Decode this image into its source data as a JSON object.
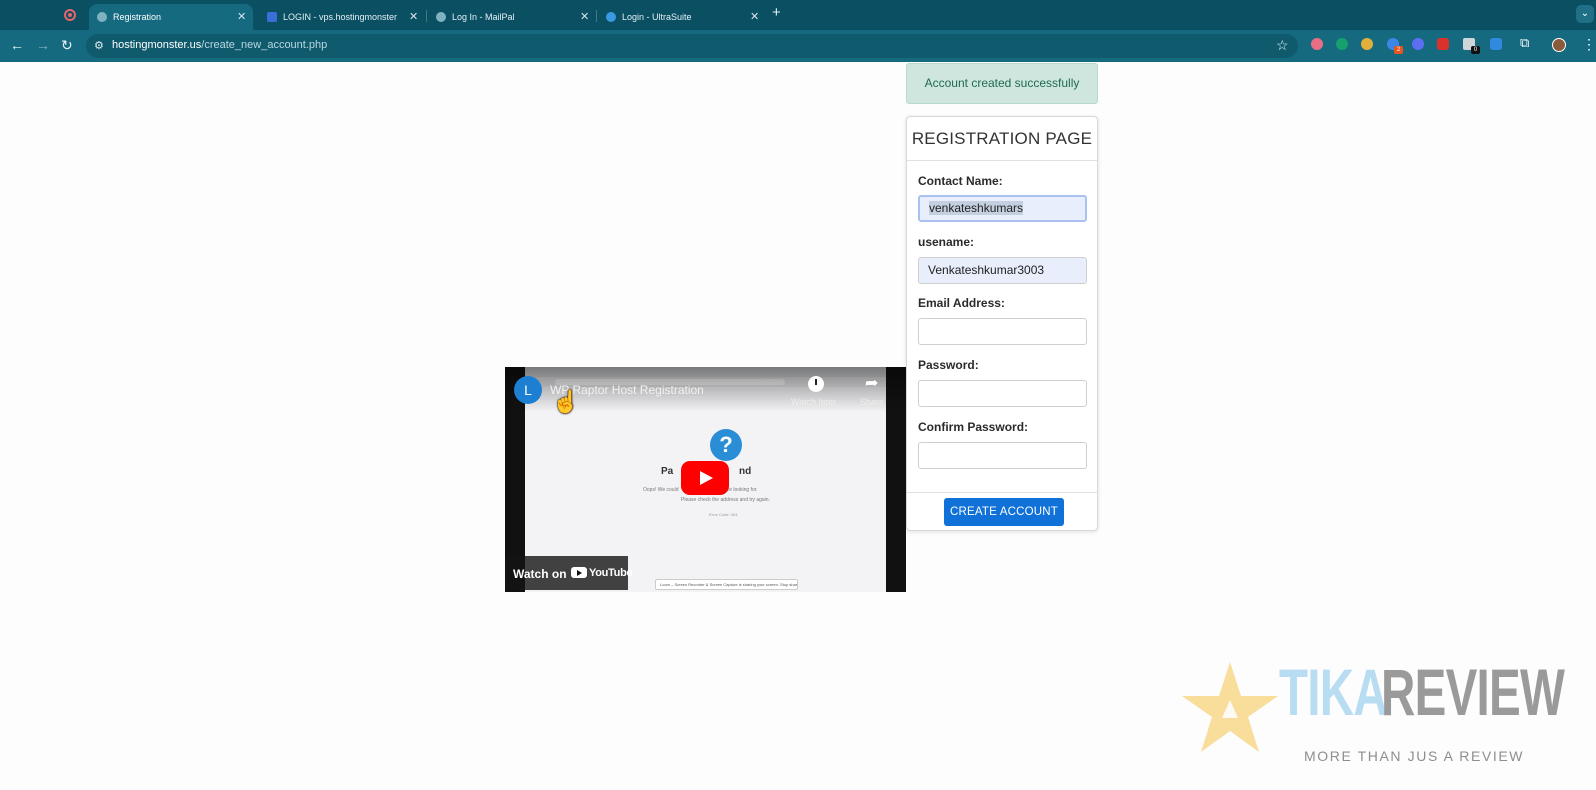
{
  "browser": {
    "tabs": [
      {
        "title": "Registration",
        "active": true
      },
      {
        "title": "LOGIN - vps.hostingmonster",
        "active": false
      },
      {
        "title": "Log In - MailPal",
        "active": false
      },
      {
        "title": "Login - UltraSuite",
        "active": false
      }
    ],
    "address": {
      "host": "hostingmonster.us",
      "path": "/create_new_account.php"
    },
    "extension_badges": [
      "2",
      "0"
    ]
  },
  "alert": {
    "message": "Account created successfully"
  },
  "form": {
    "title": "REGISTRATION PAGE",
    "fields": [
      {
        "label": "Contact Name:",
        "value": "venkateshkumars"
      },
      {
        "label": "usename:",
        "value": "Venkateshkumar3003"
      },
      {
        "label": "Email Address:",
        "value": ""
      },
      {
        "label": "Password:",
        "value": ""
      },
      {
        "label": "Confirm Password:",
        "value": ""
      }
    ],
    "submit_label": "CREATE ACCOUNT"
  },
  "video": {
    "channel_initial": "L",
    "title": "WP Raptor Host Registration",
    "watch_later": "Watch later",
    "share": "Share",
    "watch_on": "Watch on",
    "youtube": "YouTube",
    "inner_heading_left": "Pa",
    "inner_heading_right": "nd",
    "inner_line1": "Oops! We could",
    "inner_line1b": "you're looking for.",
    "inner_line2": "Please check the address and try again.",
    "inner_footer": "Error Code: 404",
    "loom_text": "Loom – Screen Recorder & Screen Capture is sharing your screen.   Stop sharing   Hide"
  },
  "watermark": {
    "word1": "TIKA",
    "word2": "REVIEW",
    "tagline": "MORE THAN JUS A REVIEW"
  },
  "colors": {
    "tabstrip": "#0b4f63",
    "toolbar": "#156a80",
    "alert_bg": "#cfe6df",
    "alert_text": "#1f6b4e",
    "button": "#1072d8",
    "watermark_blue": "#b8dcf2",
    "watermark_gray": "#9a9a9a",
    "watermark_star": "#f5d27a"
  }
}
